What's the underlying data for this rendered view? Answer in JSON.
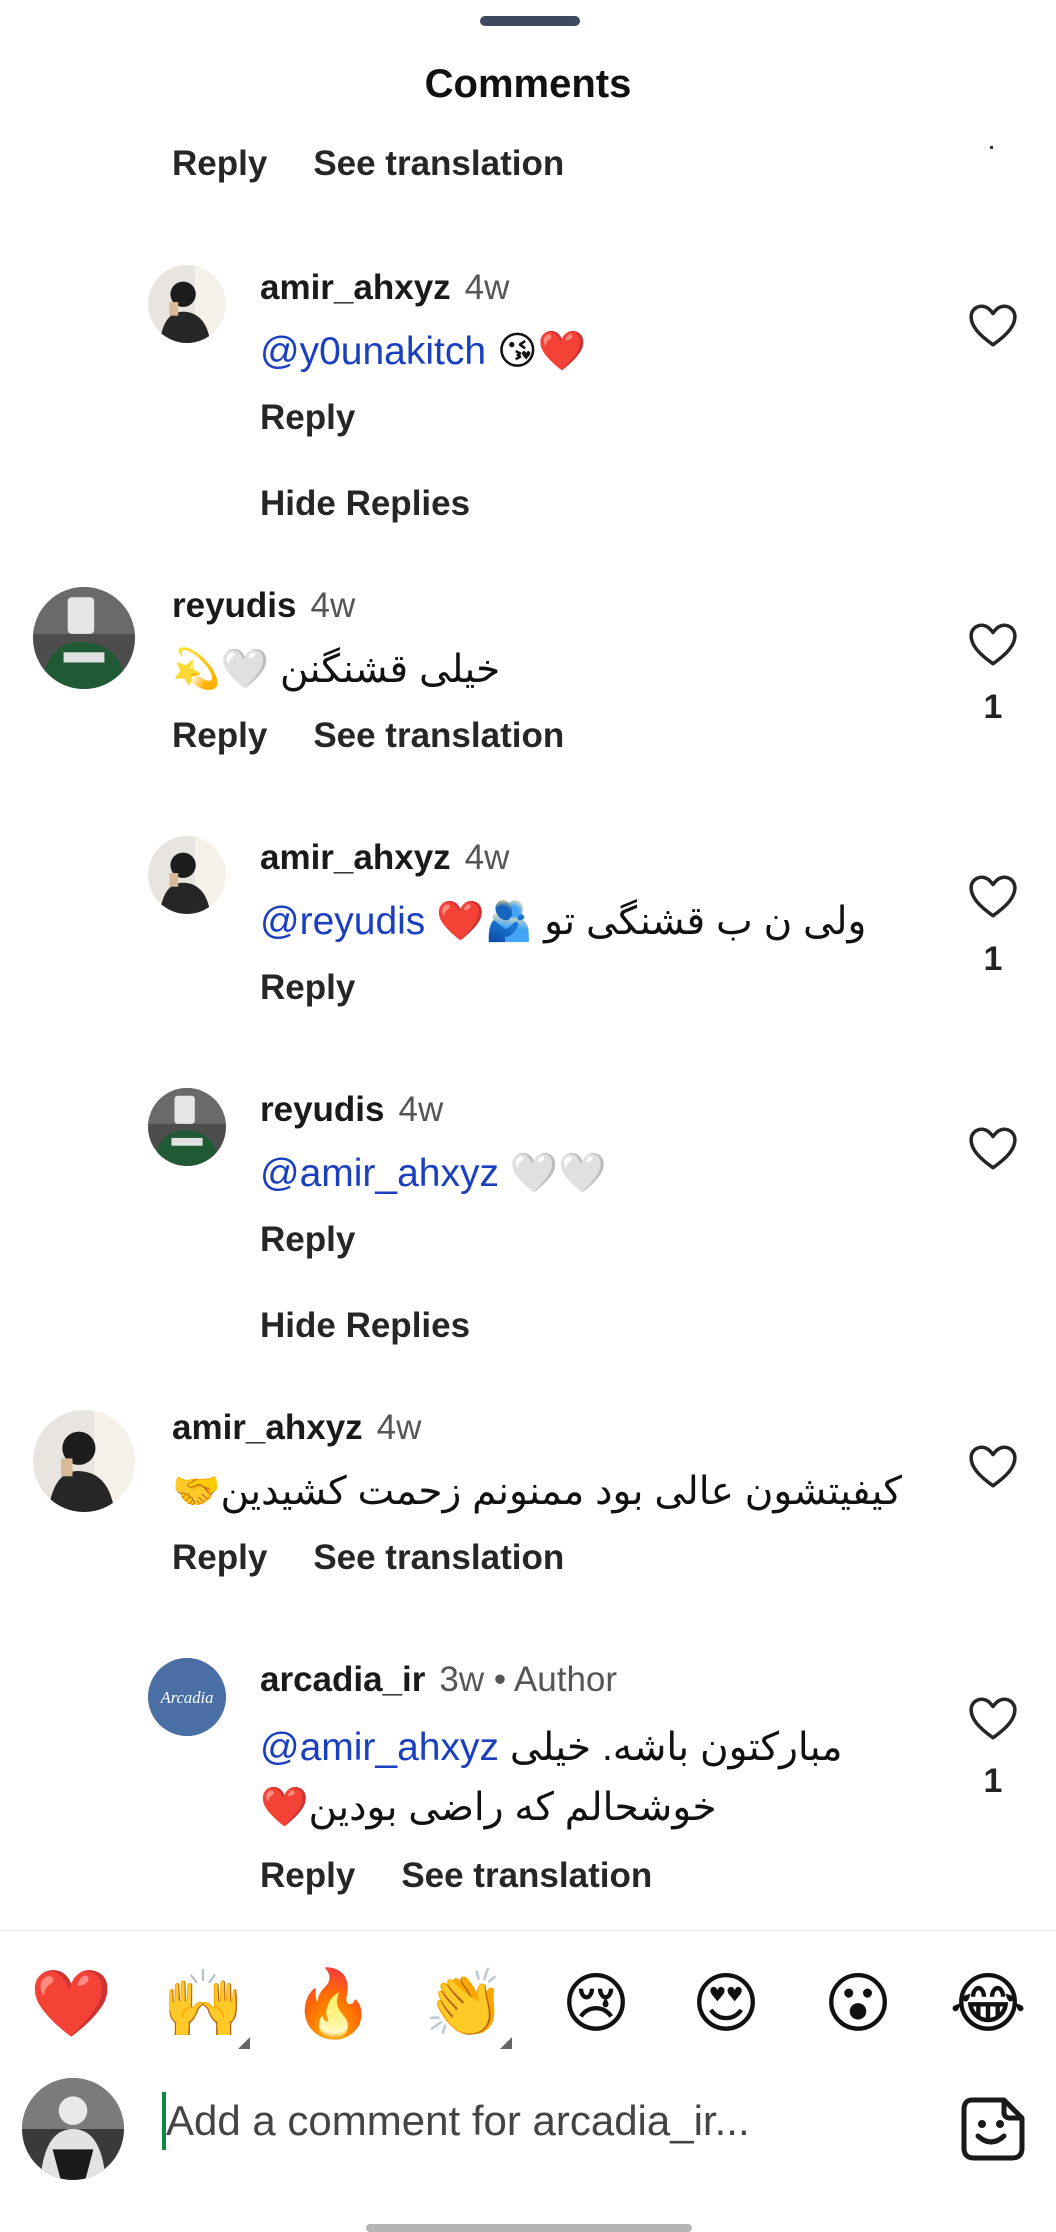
{
  "header": {
    "title": "Comments"
  },
  "top_actions": {
    "reply": "Reply",
    "translate": "See translation"
  },
  "comments": [
    {
      "user": "amir_ahxyz",
      "age": "4w",
      "mention": "@y0unakitch",
      "text": "😘❤️",
      "reply": "Reply",
      "hide_replies": "Hide Replies"
    },
    {
      "user": "reyudis",
      "age": "4w",
      "text": "خیلی قشنگنن 🤍💫",
      "likes": "1",
      "reply": "Reply",
      "translate": "See translation"
    },
    {
      "user": "amir_ahxyz",
      "age": "4w",
      "mention": "@reyudis",
      "text": "ولی ن ب قشنگی تو 🫂❤️",
      "likes": "1",
      "reply": "Reply"
    },
    {
      "user": "reyudis",
      "age": "4w",
      "mention": "@amir_ahxyz",
      "text": "🤍🤍",
      "reply": "Reply",
      "hide_replies": "Hide Replies"
    },
    {
      "user": "amir_ahxyz",
      "age": "4w",
      "text": "کیفیتشون عالی بود ممنونم زحمت کشیدین🤝",
      "reply": "Reply",
      "translate": "See translation"
    },
    {
      "user": "arcadia_ir",
      "age": "3w",
      "badge": "• Author",
      "mention": "@amir_ahxyz",
      "text": "مبارکتون باشه. خیلی",
      "text2": "خوشحالم که راضی بودین❤️",
      "likes": "1",
      "reply": "Reply",
      "translate": "See translation",
      "avatar_text": "Arcadia"
    }
  ],
  "emoji_bar": [
    "❤️",
    "🙌",
    "🔥",
    "👏",
    "😢",
    "😍",
    "😮",
    "😂"
  ],
  "composer": {
    "placeholder": "Add a comment for arcadia_ir..."
  },
  "colors": {
    "mention": "#1a3fbf",
    "arcadia_avatar": "#4a6fa5",
    "caret": "#0e8a43"
  },
  "icons": {
    "like": "heart-icon",
    "sticker": "sticker-icon"
  }
}
